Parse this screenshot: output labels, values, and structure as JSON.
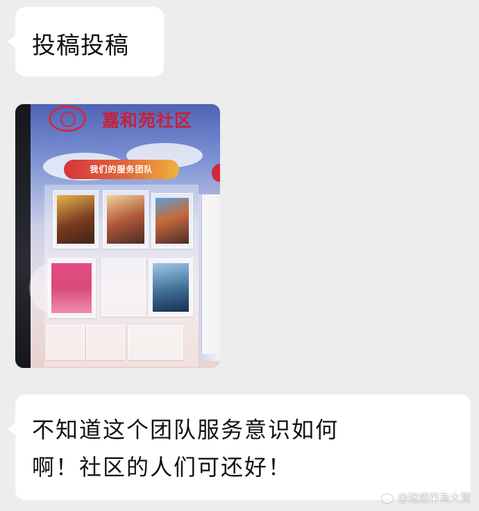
{
  "messages": [
    {
      "type": "text",
      "text": "投稿投稿"
    },
    {
      "type": "image",
      "photo": {
        "sign_title": "嘉和苑社区",
        "banner_text": "我们的服务团队"
      }
    },
    {
      "type": "text",
      "lines": [
        "不知道这个团队服务意识如何",
        "啊！社区的人们可还好！"
      ]
    }
  ],
  "watermark": {
    "icon": "weibo-icon",
    "text": "@迷惑行為大賞"
  },
  "colors": {
    "background": "#ededed",
    "bubble": "#ffffff",
    "sign_red": "#c7203a"
  }
}
